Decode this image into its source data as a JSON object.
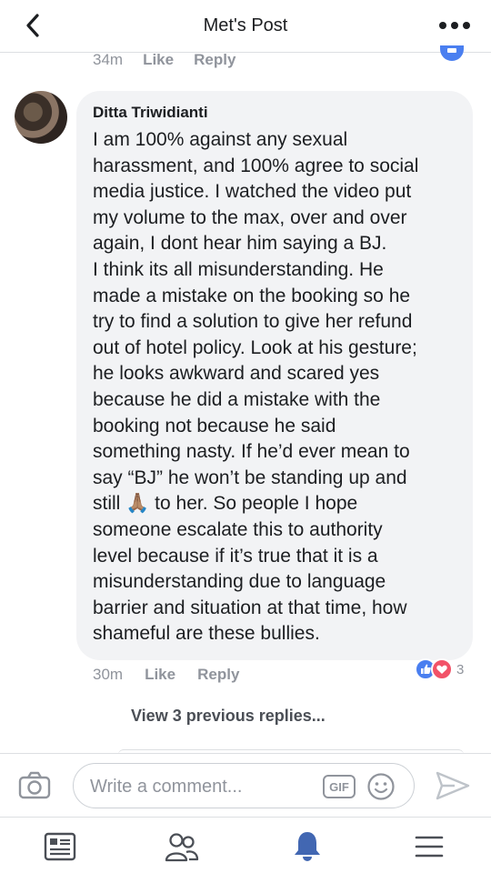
{
  "nav": {
    "title": "Met's Post",
    "back_icon": "chevron-left-icon",
    "more_icon": "more-horizontal-icon"
  },
  "previous_comment": {
    "time": "34m",
    "like_label": "Like",
    "reply_label": "Reply"
  },
  "comment": {
    "author": "Ditta Triwidianti",
    "text_part1": "I am 100% against any sexual\nharassment, and 100% agree to social\nmedia justice. I watched the video put\nmy volume to the max, over and over\nagain, I dont hear him saying a BJ.\nI think its all misunderstanding. He\nmade a mistake on the booking so he\ntry to find a solution to give her refund\nout of hotel policy. Look at his gesture;\nhe looks awkward and scared yes\nbecause he did a mistake with the\nbooking not because he said\nsomething nasty. If he’d ever mean to\nsay “BJ” he won’t be standing up and\nstill ",
    "emoji": "🙏🏽",
    "text_part2": " to her. So people I hope\nsomeone escalate this to authority\nlevel because if it’s true that it is a\nmisunderstanding due to language\nbarrier and situation at that time, how\nshameful are these bullies.",
    "time": "30m",
    "like_label": "Like",
    "reply_label": "Reply",
    "reaction_count": "3",
    "reaction_colors": {
      "like": "#4a7ff0",
      "love": "#f25268"
    }
  },
  "view_previous": "View 3 previous replies...",
  "composer": {
    "placeholder": "Write a comment...",
    "gif_label": "GIF"
  },
  "tabbar": [
    "news-feed-icon",
    "friends-icon",
    "notifications-bell-icon",
    "menu-icon"
  ],
  "colors": {
    "accent": "#4267b2",
    "bubble": "#f2f3f5",
    "meta_gray": "#90949c"
  }
}
